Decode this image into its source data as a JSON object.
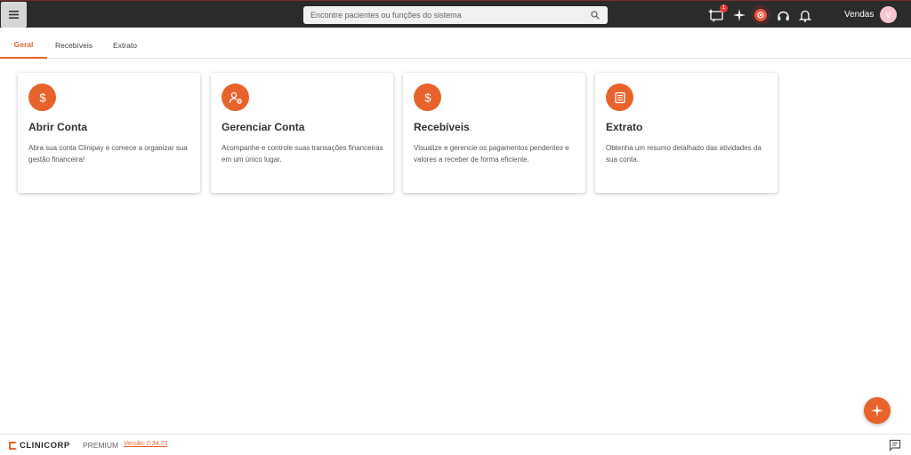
{
  "topbar": {
    "search": {
      "placeholder": "Encontre pacientes ou funções do sistema"
    },
    "notifications_badge": "1",
    "user": {
      "name": "Vendas",
      "initial": "V"
    },
    "icons": [
      "menu-icon",
      "search-icon",
      "chat-notification-icon",
      "sparkle-icon",
      "record-icon",
      "headset-icon",
      "bell-icon"
    ]
  },
  "tabs": [
    {
      "label": "Geral",
      "active": true
    },
    {
      "label": "Recebíveis",
      "active": false
    },
    {
      "label": "Extrato",
      "active": false
    }
  ],
  "cards": [
    {
      "title": "Abrir Conta",
      "description": "Abra sua conta Clinipay e comece a organizar sua gestão financeira!",
      "icon": "dollar-icon"
    },
    {
      "title": "Gerenciar Conta",
      "description": "Acompanhe e controle suas transações financeiras em um único lugar.",
      "icon": "user-settings-icon"
    },
    {
      "title": "Recebíveis",
      "description": "Visualize e gerencie os pagamentos pendentes e valores a receber de forma eficiente.",
      "icon": "dollar-icon"
    },
    {
      "title": "Extrato",
      "description": "Obtenha um resumo detalhado das atividades da sua conta.",
      "icon": "statement-icon"
    }
  ],
  "footer": {
    "brand": "CLINICORP",
    "plan": "PREMIUM",
    "version": "Versão: 0.34.73"
  },
  "colors": {
    "accent": "#e8632b",
    "topbar": "#2b2b2b",
    "badge": "#e53935"
  }
}
